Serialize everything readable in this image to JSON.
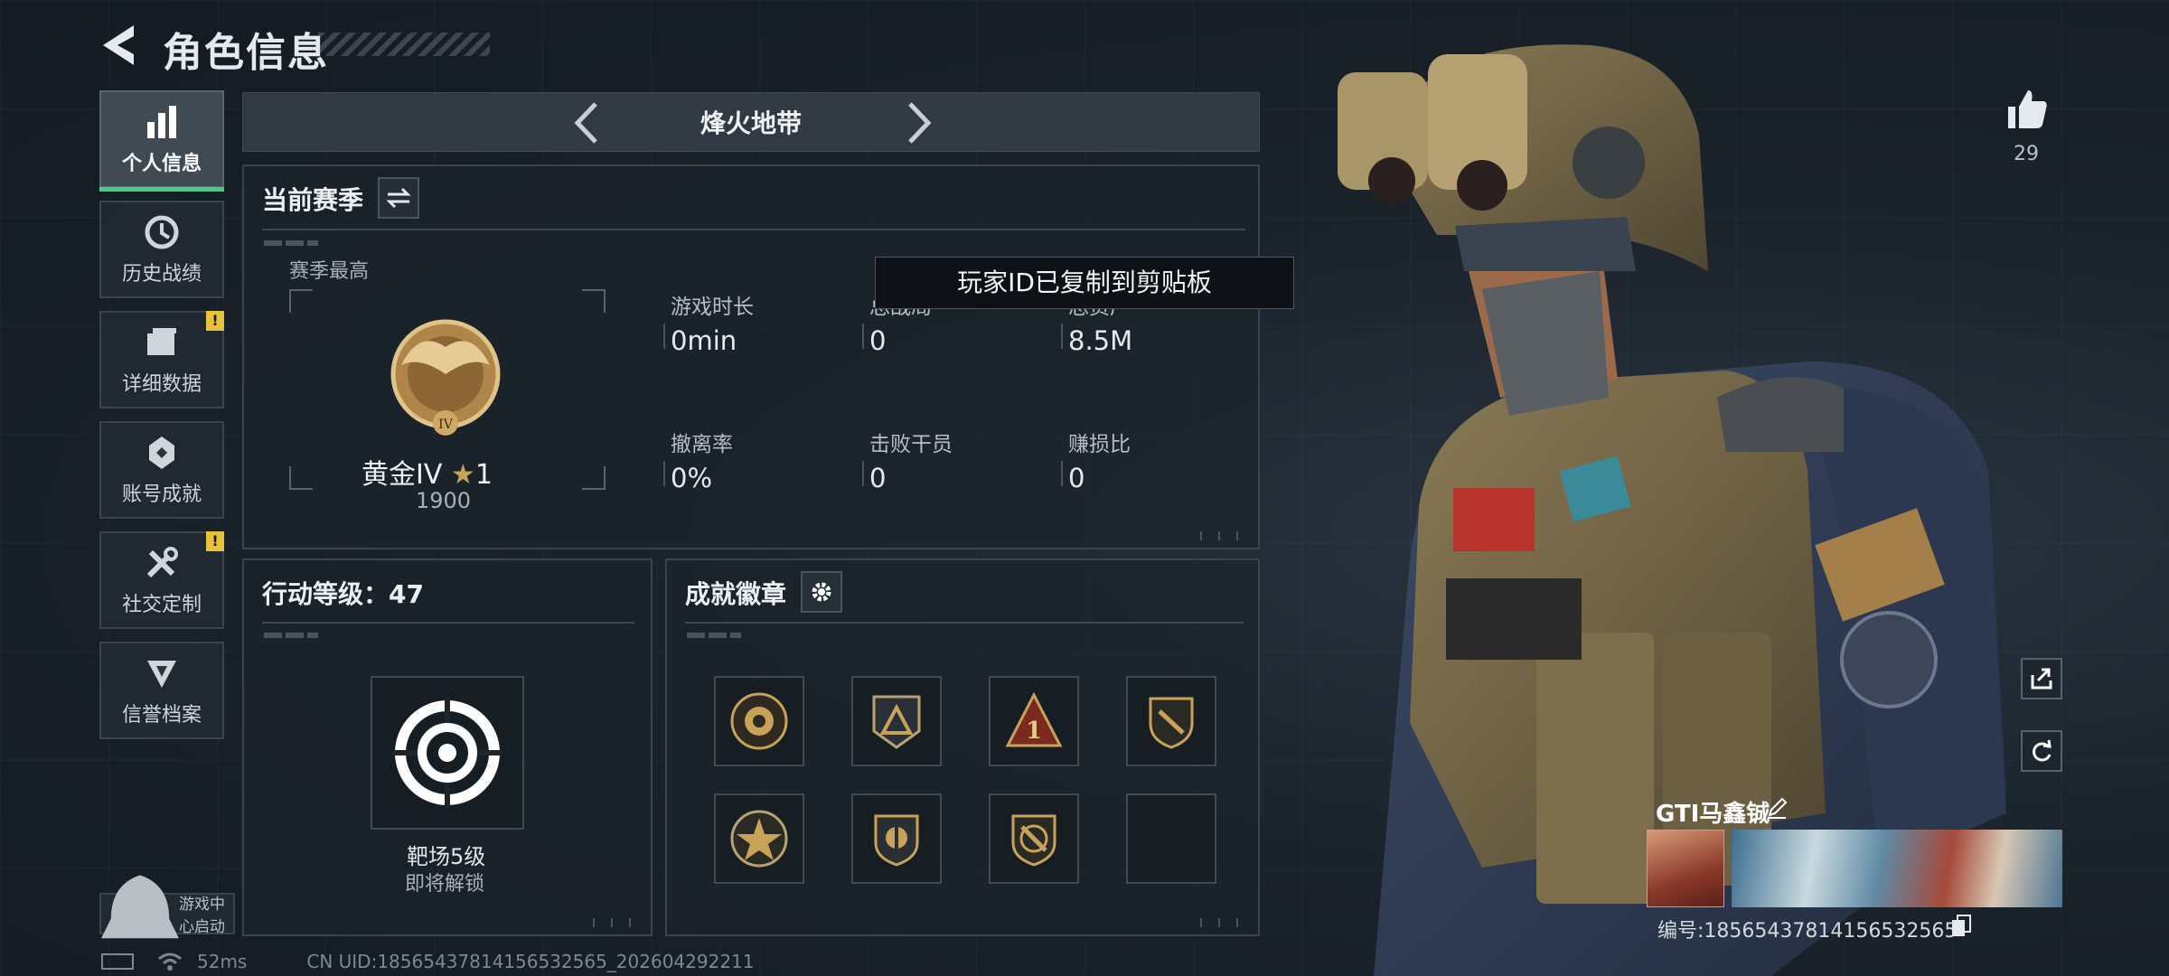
{
  "header": {
    "title": "角色信息"
  },
  "nav": {
    "items": [
      {
        "label": "个人信息",
        "active": true,
        "icon": "bar-chart-icon",
        "badge": ""
      },
      {
        "label": "历史战绩",
        "active": false,
        "icon": "history-clock-icon",
        "badge": ""
      },
      {
        "label": "详细数据",
        "active": false,
        "icon": "folder-icon",
        "badge": "!"
      },
      {
        "label": "账号成就",
        "active": false,
        "icon": "achievement-icon",
        "badge": ""
      },
      {
        "label": "社交定制",
        "active": false,
        "icon": "tools-icon",
        "badge": "!"
      },
      {
        "label": "信誉档案",
        "active": false,
        "icon": "reputation-icon",
        "badge": ""
      }
    ],
    "launch_label": "游戏中心启动"
  },
  "mode": {
    "title": "烽火地带"
  },
  "season": {
    "title": "当前赛季",
    "peak_label": "赛季最高",
    "rank_name": "黄金IV",
    "rank_stars": "1",
    "rank_emblem_numeral": "IV",
    "rank_score": "1900",
    "stats": [
      {
        "label": "游戏时长",
        "value": "0min"
      },
      {
        "label": "总战局",
        "value": "0"
      },
      {
        "label": "总资产",
        "value": "8.5M"
      },
      {
        "label": "撤离率",
        "value": "0%"
      },
      {
        "label": "击败干员",
        "value": "0"
      },
      {
        "label": "赚损比",
        "value": "0"
      }
    ]
  },
  "toast": {
    "text": "玩家ID已复制到剪贴板"
  },
  "action_level": {
    "title": "行动等级：47",
    "item_name": "靶场5级",
    "item_sub": "即将解锁"
  },
  "badges": {
    "title": "成就徽章",
    "slots": [
      "emblem-badge-icon",
      "triangle-badge-icon",
      "rank-one-badge-icon",
      "shield-badge-icon",
      "star-badge-icon",
      "crest-badge-icon",
      "knife-badge-icon",
      "empty-slot"
    ]
  },
  "profile": {
    "likes": "29",
    "name": "GTI马鑫铖",
    "id_label": "编号:18565437814156532565"
  },
  "status_bar": {
    "ping": "52ms",
    "uid": "CN UID:18565437814156532565_202604292211"
  },
  "colors": {
    "accent_green": "#3ed07a",
    "warning": "#e8c23a",
    "gold": "#c9a25a"
  }
}
